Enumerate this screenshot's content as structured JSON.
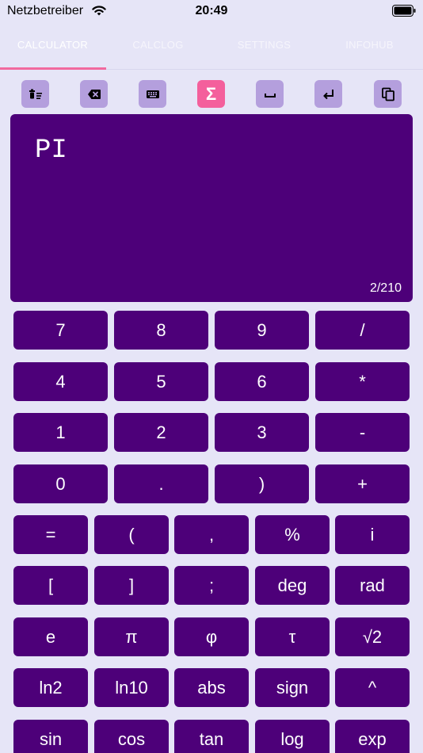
{
  "status": {
    "carrier": "Netzbetreiber",
    "time": "20:49"
  },
  "tabs": [
    "CALCULATOR",
    "CALCLOG",
    "SETTINGS",
    "INFOHUB"
  ],
  "toolbar": {
    "icons": [
      "clear-all-icon",
      "backspace-icon",
      "keyboard-icon",
      "sigma-icon",
      "space-icon",
      "return-icon",
      "copy-icon"
    ],
    "sigma_label": "Σ"
  },
  "display": {
    "expression": "PI",
    "counter": "2/210"
  },
  "keys": {
    "row1": [
      "7",
      "8",
      "9",
      "/"
    ],
    "row2": [
      "4",
      "5",
      "6",
      "*"
    ],
    "row3": [
      "1",
      "2",
      "3",
      "-"
    ],
    "row4": [
      "0",
      ".",
      ")",
      "+"
    ],
    "row5": [
      "=",
      "(",
      ",",
      "%",
      "i"
    ],
    "row6": [
      "[",
      "]",
      ";",
      "deg",
      "rad"
    ],
    "row7": [
      "e",
      "π",
      "φ",
      "τ",
      "√2"
    ],
    "row8": [
      "ln2",
      "ln10",
      "abs",
      "sign",
      "^"
    ],
    "row9": [
      "sin",
      "cos",
      "tan",
      "log",
      "exp"
    ]
  },
  "colors": {
    "background": "#e6e5f7",
    "key": "#4d0079",
    "accent": "#f45f9c",
    "tool": "#b49fdd"
  }
}
